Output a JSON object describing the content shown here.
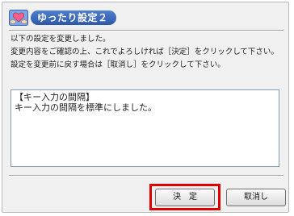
{
  "dialog": {
    "title": "ゆったり設定２"
  },
  "message": {
    "line1": "以下の設定を変更しました。",
    "line2": "変更内容をご確認の上、これでよろしければ［決定］をクリックして下さい。",
    "line3": "設定を変更前に戻す場合は［取消し］をクリックして下さい。"
  },
  "details": {
    "heading": "【キー入力の間隔】",
    "body": "キー入力の間隔を標準にしました。"
  },
  "buttons": {
    "ok_label": "決　定",
    "cancel_label": "取消し"
  },
  "colors": {
    "title_pill": "#2d58a8",
    "highlight": "#e00000"
  },
  "icons": {
    "title_icon": "heart-hands-icon"
  }
}
